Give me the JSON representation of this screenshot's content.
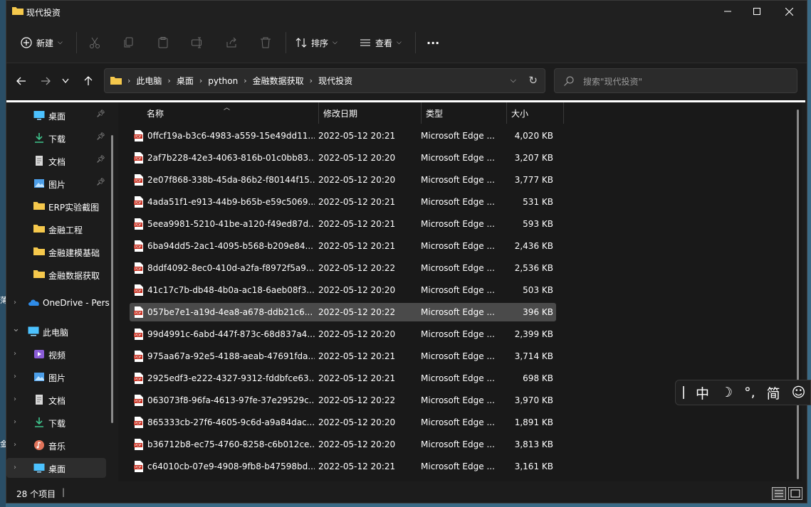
{
  "window": {
    "title": "现代投资"
  },
  "toolbar": {
    "new_label": "新建",
    "sort_label": "排序",
    "view_label": "查看",
    "more_label": "···"
  },
  "address": {
    "crumbs": [
      "此电脑",
      "桌面",
      "python",
      "金融数据获取",
      "现代投资"
    ]
  },
  "search": {
    "placeholder": "搜索\"现代投资\""
  },
  "sidebar": {
    "items": [
      {
        "label": "桌面",
        "icon": "desktop-icon",
        "pinned": true
      },
      {
        "label": "下载",
        "icon": "download-icon",
        "pinned": true
      },
      {
        "label": "文档",
        "icon": "document-icon",
        "pinned": true
      },
      {
        "label": "图片",
        "icon": "pictures-icon",
        "pinned": true
      },
      {
        "label": "ERP实验截图",
        "icon": "folder-icon",
        "pinned": false
      },
      {
        "label": "金融工程",
        "icon": "folder-icon",
        "pinned": false
      },
      {
        "label": "金融建模基础",
        "icon": "folder-icon",
        "pinned": false
      },
      {
        "label": "金融数据获取",
        "icon": "folder-icon",
        "pinned": false
      },
      {
        "label": "OneDrive - Pers",
        "icon": "cloud-icon",
        "pinned": false
      },
      {
        "label": "此电脑",
        "icon": "computer-icon",
        "pinned": false
      },
      {
        "label": "视频",
        "icon": "video-icon",
        "pinned": false
      },
      {
        "label": "图片",
        "icon": "pictures-icon",
        "pinned": false
      },
      {
        "label": "文档",
        "icon": "document-icon",
        "pinned": false
      },
      {
        "label": "下载",
        "icon": "download-icon",
        "pinned": false
      },
      {
        "label": "音乐",
        "icon": "music-icon",
        "pinned": false
      },
      {
        "label": "桌面",
        "icon": "desktop-icon",
        "pinned": false
      }
    ]
  },
  "columns": {
    "name": "名称",
    "date": "修改日期",
    "type": "类型",
    "size": "大小"
  },
  "files": [
    {
      "name": "0ffcf19a-b3c6-4983-a559-15e49dd11...",
      "date": "2022-05-12 20:21",
      "type": "Microsoft Edge ...",
      "size": "4,020 KB"
    },
    {
      "name": "2af7b228-42e3-4063-816b-01c0bb83...",
      "date": "2022-05-12 20:20",
      "type": "Microsoft Edge ...",
      "size": "3,207 KB"
    },
    {
      "name": "2e07f868-338b-45da-86b2-f80144f15...",
      "date": "2022-05-12 20:20",
      "type": "Microsoft Edge ...",
      "size": "3,777 KB"
    },
    {
      "name": "4ada51f1-e913-44b9-b65b-e59c5069...",
      "date": "2022-05-12 20:21",
      "type": "Microsoft Edge ...",
      "size": "531 KB"
    },
    {
      "name": "5eea9981-5210-41be-a120-f49ed87d...",
      "date": "2022-05-12 20:21",
      "type": "Microsoft Edge ...",
      "size": "593 KB"
    },
    {
      "name": "6ba94dd5-2ac1-4095-b568-b209e84...",
      "date": "2022-05-12 20:21",
      "type": "Microsoft Edge ...",
      "size": "2,436 KB"
    },
    {
      "name": "8ddf4092-8ec0-410d-a2fa-f8972f5a9...",
      "date": "2022-05-12 20:22",
      "type": "Microsoft Edge ...",
      "size": "2,536 KB"
    },
    {
      "name": "41c17c7b-db48-4b0a-ac18-6aeb08f3...",
      "date": "2022-05-12 20:20",
      "type": "Microsoft Edge ...",
      "size": "503 KB"
    },
    {
      "name": "057be7e1-a19d-4ea8-a678-ddb21c6...",
      "date": "2022-05-12 20:22",
      "type": "Microsoft Edge ...",
      "size": "396 KB"
    },
    {
      "name": "99d4991c-6abd-447f-873c-68d837a4...",
      "date": "2022-05-12 20:20",
      "type": "Microsoft Edge ...",
      "size": "2,399 KB"
    },
    {
      "name": "975aa67a-92e5-4188-aeab-47691fda...",
      "date": "2022-05-12 20:21",
      "type": "Microsoft Edge ...",
      "size": "3,714 KB"
    },
    {
      "name": "2925edf3-e222-4327-9312-fddbfce63...",
      "date": "2022-05-12 20:21",
      "type": "Microsoft Edge ...",
      "size": "698 KB"
    },
    {
      "name": "063073f8-96fa-4613-97fe-37e29529c...",
      "date": "2022-05-12 20:22",
      "type": "Microsoft Edge ...",
      "size": "3,970 KB"
    },
    {
      "name": "865333cb-27f6-4605-9c6d-a9a84dac...",
      "date": "2022-05-12 20:20",
      "type": "Microsoft Edge ...",
      "size": "1,891 KB"
    },
    {
      "name": "b36712b8-ec75-4760-8258-c6b012ce...",
      "date": "2022-05-12 20:20",
      "type": "Microsoft Edge ...",
      "size": "3,813 KB"
    },
    {
      "name": "c64010cb-07e9-4908-9fb8-b47598bd...",
      "date": "2022-05-12 20:21",
      "type": "Microsoft Edge ...",
      "size": "3,161 KB"
    }
  ],
  "selected_row": 8,
  "status": {
    "count": "28 个项目"
  },
  "ime": {
    "mode": "中",
    "moon": "☽",
    "punct": "°,",
    "script": "简",
    "emoji": "☺"
  },
  "colors": {
    "pdf": "#c42b1c",
    "folder": "#f5c84c",
    "accent": "#4cc2ff"
  }
}
